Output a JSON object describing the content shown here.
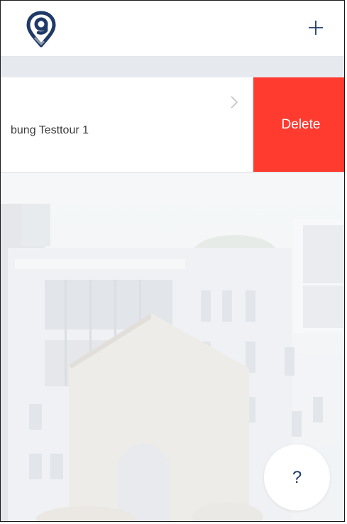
{
  "header": {
    "logo_icon": "location-pin-g-logo",
    "add_icon": "plus-icon"
  },
  "list": {
    "rows": [
      {
        "title": "bung Testtour 1",
        "chevron_icon": "chevron-right-icon",
        "delete_label": "Delete"
      }
    ]
  },
  "help": {
    "label": "?"
  },
  "colors": {
    "brand": "#1f3a68",
    "delete": "#ff3b30"
  }
}
